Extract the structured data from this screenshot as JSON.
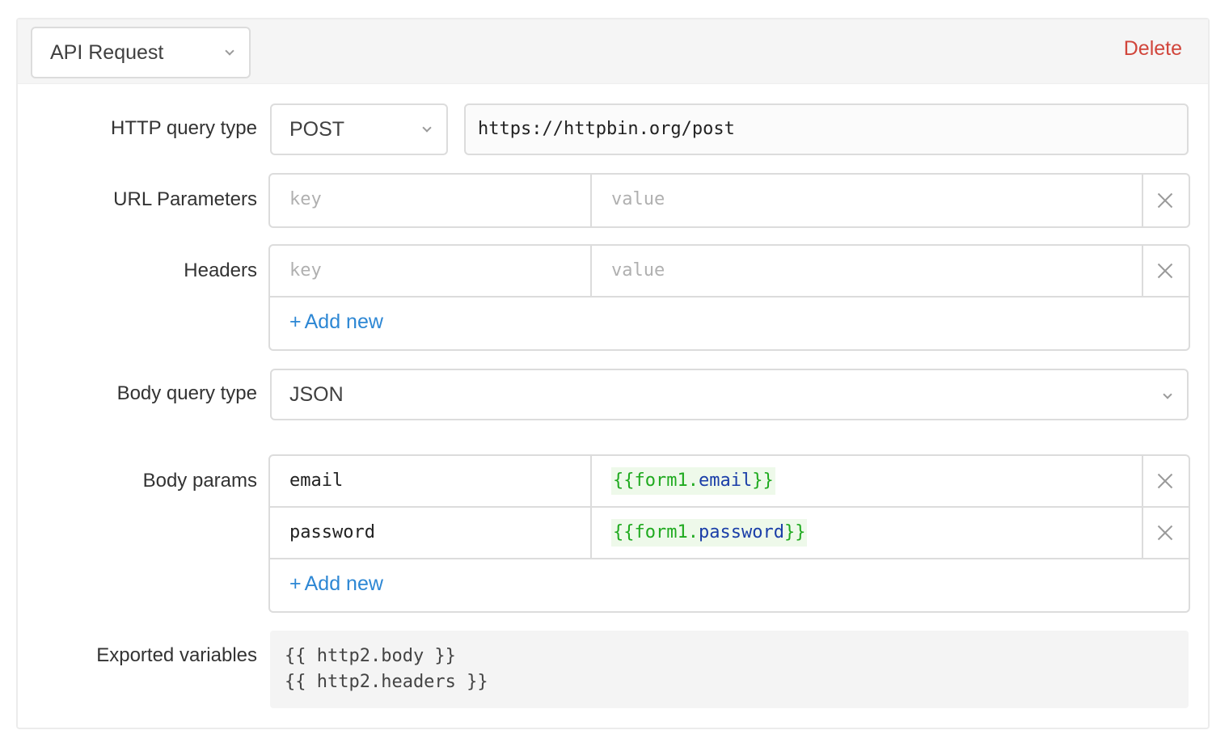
{
  "step": {
    "type_label": "API Request",
    "delete_label": "Delete"
  },
  "http": {
    "label": "HTTP query type",
    "method": "POST",
    "url": "https://httpbin.org/post"
  },
  "url_params": {
    "label": "URL Parameters",
    "rows": [
      {
        "key_placeholder": "key",
        "value_placeholder": "value"
      }
    ]
  },
  "headers": {
    "label": "Headers",
    "rows": [
      {
        "key_placeholder": "key",
        "value_placeholder": "value"
      }
    ],
    "add_label": "Add new"
  },
  "body_type": {
    "label": "Body query type",
    "value": "JSON"
  },
  "body_params": {
    "label": "Body params",
    "rows": [
      {
        "key": "email",
        "value_open": "{{",
        "value_obj": "form1.",
        "value_prop": "email",
        "value_close": "}}"
      },
      {
        "key": "password",
        "value_open": "{{",
        "value_obj": "form1.",
        "value_prop": "password",
        "value_close": "}}"
      }
    ],
    "add_label": "Add new"
  },
  "exported": {
    "label": "Exported variables",
    "lines": [
      "{{ http2.body }}",
      "{{ http2.headers }}"
    ]
  },
  "colors": {
    "delete": "#d1453b",
    "link": "#2d87d4",
    "template_bracket": "#1faa1f",
    "template_prop": "#1a3ea8",
    "template_bg": "#eef9ea"
  },
  "icons": {
    "remove": "close-icon",
    "dropdown": "chevron-down-icon",
    "add": "plus-icon"
  }
}
